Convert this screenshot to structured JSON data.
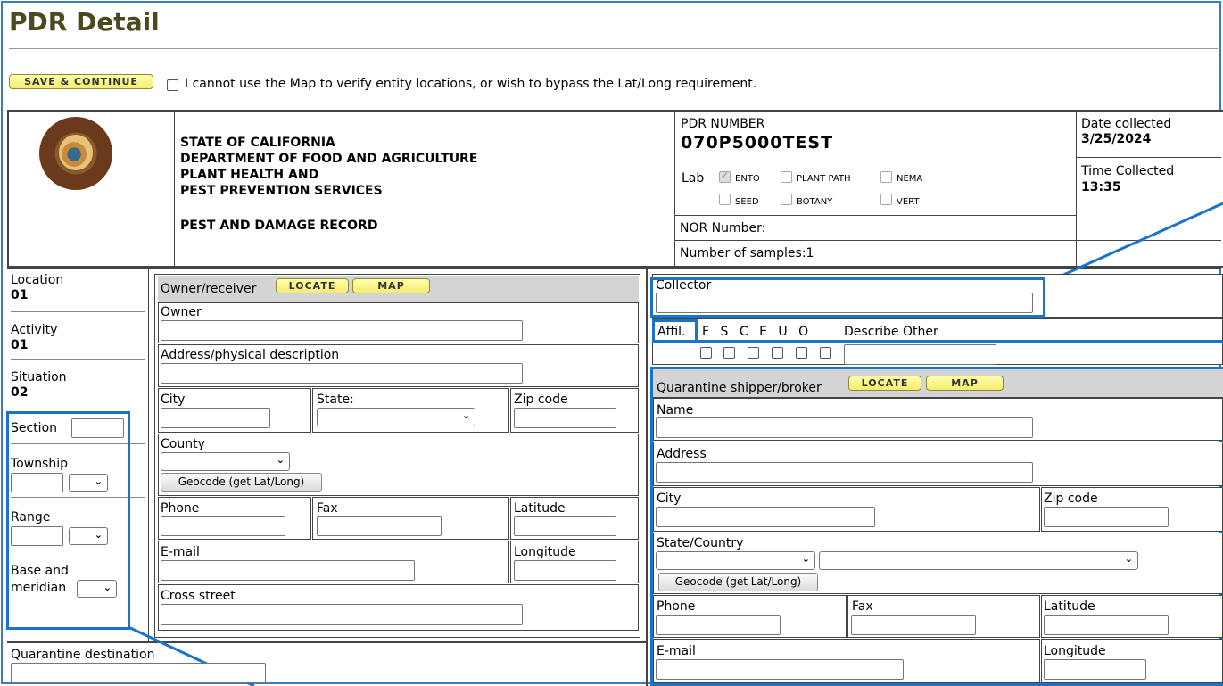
{
  "page": {
    "title": "PDR Detail"
  },
  "top": {
    "save_label": "SAVE & CONTINUE",
    "bypass_label": "I cannot use the Map to verify entity locations, or wish to bypass the Lat/Long requirement."
  },
  "header": {
    "agency_lines": [
      "STATE OF CALIFORNIA",
      "DEPARTMENT OF FOOD AND AGRICULTURE",
      "PLANT HEALTH AND",
      "PEST PREVENTION SERVICES"
    ],
    "record_title": "PEST AND DAMAGE RECORD",
    "pdr_label": "PDR NUMBER",
    "pdr_value": "070P5000TEST",
    "date_label": "Date collected",
    "date_value": "3/25/2024",
    "time_label": "Time Collected",
    "time_value": "13:35",
    "lab_label": "Lab",
    "lab_options": [
      {
        "label": "ENTO",
        "checked": true
      },
      {
        "label": "PLANT PATH",
        "checked": false
      },
      {
        "label": "NEMA",
        "checked": false
      },
      {
        "label": "SEED",
        "checked": false
      },
      {
        "label": "BOTANY",
        "checked": false
      },
      {
        "label": "VERT",
        "checked": false
      }
    ],
    "nor_label": "NOR Number:",
    "samples_label": "Number of samples:1"
  },
  "left": {
    "location_label": "Location",
    "location_value": "01",
    "activity_label": "Activity",
    "activity_value": "01",
    "situation_label": "Situation",
    "situation_value": "02",
    "section_label": "Section",
    "township_label": "Township",
    "range_label": "Range",
    "base_label_1": "Base and",
    "base_label_2": "meridian",
    "quarantine_dest_label": "Quarantine destination"
  },
  "owner": {
    "header": "Owner/receiver",
    "locate_label": "LOCATE",
    "map_label": "MAP",
    "owner_label": "Owner",
    "address_label": "Address/physical description",
    "city_label": "City",
    "state_label": "State:",
    "zip_label": "Zip code",
    "county_label": "County",
    "geocode_label": "Geocode (get Lat/Long)",
    "phone_label": "Phone",
    "fax_label": "Fax",
    "latitude_label": "Latitude",
    "email_label": "E-mail",
    "longitude_label": "Longitude",
    "cross_label": "Cross street"
  },
  "collector": {
    "label": "Collector",
    "affil_label": "Affil.",
    "affil_codes": [
      "F",
      "S",
      "C",
      "E",
      "U",
      "O"
    ],
    "describe_other": "Describe Other"
  },
  "shipper": {
    "header": "Quarantine shipper/broker",
    "locate_label": "LOCATE",
    "map_label": "MAP",
    "name_label": "Name",
    "address_label": "Address",
    "city_label": "City",
    "zip_label": "Zip code",
    "state_country_label": "State/Country",
    "geocode_label": "Geocode (get Lat/Long)",
    "phone_label": "Phone",
    "fax_label": "Fax",
    "latitude_label": "Latitude",
    "email_label": "E-mail",
    "longitude_label": "Longitude"
  },
  "colors": {
    "callout": "#1a73c8",
    "title": "#4a4a1e",
    "button_yellow": "#f4ec70"
  }
}
